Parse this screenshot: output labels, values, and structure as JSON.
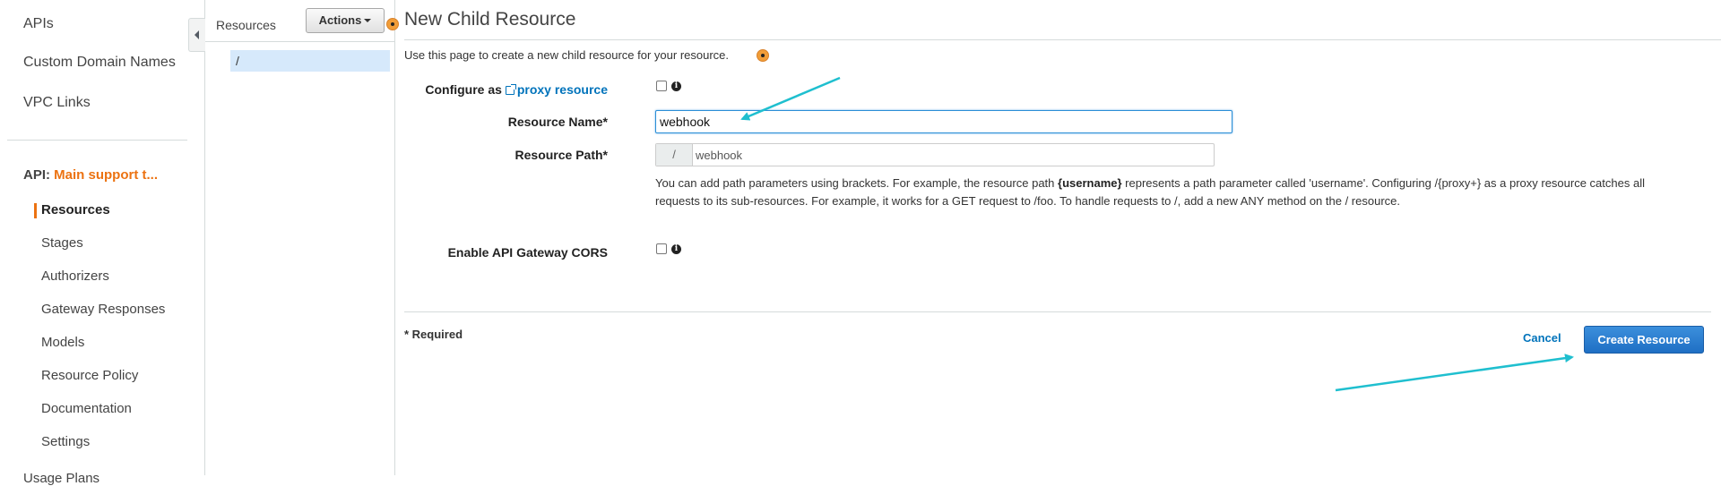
{
  "leftnav": {
    "top_links": [
      "APIs",
      "Custom Domain Names",
      "VPC Links"
    ],
    "api_prefix": "API:",
    "api_name": "Main support t...",
    "sub_items": [
      "Resources",
      "Stages",
      "Authorizers",
      "Gateway Responses",
      "Models",
      "Resource Policy",
      "Documentation",
      "Settings"
    ],
    "active_item": "Resources",
    "cutoff_item": "Usage Plans"
  },
  "resources_panel": {
    "title": "Resources",
    "actions_label": "Actions",
    "tree_root": "/"
  },
  "main": {
    "title": "New Child Resource",
    "intro": "Use this page to create a new child resource for your resource.",
    "proxy": {
      "label_prefix": "Configure as",
      "link_text": "proxy resource",
      "checked": false
    },
    "resource_name": {
      "label": "Resource Name*",
      "value": "webhook"
    },
    "resource_path": {
      "label": "Resource Path*",
      "prefix": "/",
      "value": "webhook"
    },
    "help": {
      "part1": "You can add path parameters using brackets. For example, the resource path ",
      "bold": "{username}",
      "part2": " represents a path parameter called 'username'. Configuring /{proxy+} as a proxy resource catches all requests to its sub-resources. For example, it works for a GET request to /foo. To handle requests to /, add a new ANY method on the / resource."
    },
    "cors": {
      "label": "Enable API Gateway CORS",
      "checked": false
    },
    "required_note": "* Required",
    "cancel_label": "Cancel",
    "create_label": "Create Resource"
  },
  "colors": {
    "accent_orange": "#ec7211",
    "link_blue": "#0073bb",
    "primary_button": "#1f6fc4",
    "annotation_arrow": "#1fbfcf",
    "selected_row": "#d6e9fb"
  },
  "icons": [
    "external-link-icon",
    "info-icon",
    "collapse-caret-icon",
    "dropdown-caret-icon",
    "orange-dot-icon"
  ]
}
